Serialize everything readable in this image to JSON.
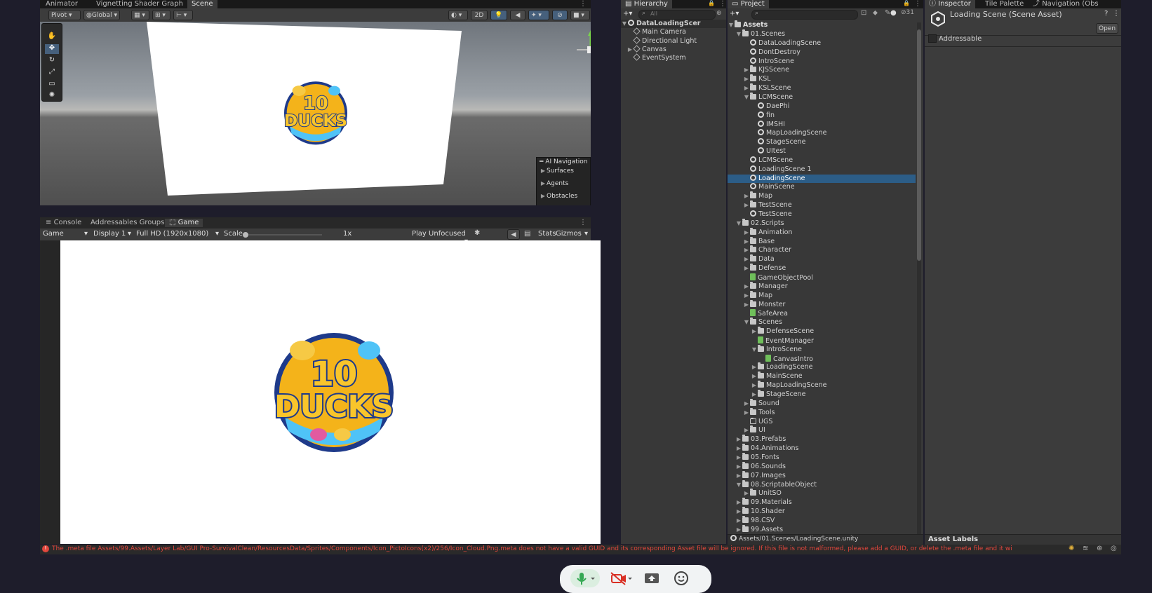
{
  "top_tabs": {
    "animator": "Animator",
    "vignetting": "Vignetting Shader Graph",
    "scene": "Scene",
    "hierarchy": "Hierarchy",
    "project": "Project",
    "inspector": "Inspector",
    "tile_palette": "Tile Palette",
    "navigation": "Navigation (Obs"
  },
  "scene_toolbar": {
    "pivot": "Pivot",
    "global": "Global",
    "mode_2d": "2D"
  },
  "ai_navigation": {
    "title": "AI Navigation",
    "items": [
      "Surfaces",
      "Agents",
      "Obstacles"
    ]
  },
  "bottom_tabs": {
    "console": "Console",
    "addressables": "Addressables Groups",
    "game": "Game"
  },
  "game_toolbar": {
    "view": "Game",
    "display": "Display 1",
    "resolution": "Full HD (1920x1080)",
    "scale_label": "Scale",
    "scale_value": "1x",
    "play_mode": "Play Unfocused",
    "stats": "Stats",
    "gizmos": "Gizmos"
  },
  "logo": {
    "line1": "10",
    "line2": "DUCKS"
  },
  "hierarchy": {
    "search_placeholder": "All",
    "scene": "DataLoadingScer",
    "items": [
      "Main Camera",
      "Directional Light",
      "Canvas",
      "EventSystem"
    ]
  },
  "project": {
    "hidden_count": "31",
    "root": "Assets",
    "path": "Assets/01.Scenes/LoadingScene.unity",
    "tree": [
      {
        "label": "01.Scenes",
        "depth": 1,
        "icon": "folder-open",
        "arrow": "open"
      },
      {
        "label": "DataLoadingScene",
        "depth": 2,
        "icon": "unity"
      },
      {
        "label": "DontDestroy",
        "depth": 2,
        "icon": "unity"
      },
      {
        "label": "IntroScene",
        "depth": 2,
        "icon": "unity"
      },
      {
        "label": "KJSScene",
        "depth": 2,
        "icon": "folder",
        "arrow": "closed"
      },
      {
        "label": "KSL",
        "depth": 2,
        "icon": "folder",
        "arrow": "closed"
      },
      {
        "label": "KSLScene",
        "depth": 2,
        "icon": "folder",
        "arrow": "closed"
      },
      {
        "label": "LCMScene",
        "depth": 2,
        "icon": "folder-open",
        "arrow": "open"
      },
      {
        "label": "DaePhi",
        "depth": 3,
        "icon": "unity"
      },
      {
        "label": "fin",
        "depth": 3,
        "icon": "unity"
      },
      {
        "label": "IMSHI",
        "depth": 3,
        "icon": "unity"
      },
      {
        "label": "MapLoadingScene",
        "depth": 3,
        "icon": "unity"
      },
      {
        "label": "StageScene",
        "depth": 3,
        "icon": "unity"
      },
      {
        "label": "UItest",
        "depth": 3,
        "icon": "unity"
      },
      {
        "label": "LCMScene",
        "depth": 2,
        "icon": "unity"
      },
      {
        "label": "LoadingScene 1",
        "depth": 2,
        "icon": "unity"
      },
      {
        "label": "LoadingScene",
        "depth": 2,
        "icon": "unity",
        "selected": true
      },
      {
        "label": "MainScene",
        "depth": 2,
        "icon": "unity"
      },
      {
        "label": "Map",
        "depth": 2,
        "icon": "folder",
        "arrow": "closed"
      },
      {
        "label": "TestScene",
        "depth": 2,
        "icon": "folder",
        "arrow": "closed"
      },
      {
        "label": "TestScene",
        "depth": 2,
        "icon": "unity"
      },
      {
        "label": "02.Scripts",
        "depth": 1,
        "icon": "folder-open",
        "arrow": "open"
      },
      {
        "label": "Animation",
        "depth": 2,
        "icon": "folder",
        "arrow": "closed"
      },
      {
        "label": "Base",
        "depth": 2,
        "icon": "folder",
        "arrow": "closed"
      },
      {
        "label": "Character",
        "depth": 2,
        "icon": "folder",
        "arrow": "closed"
      },
      {
        "label": "Data",
        "depth": 2,
        "icon": "folder",
        "arrow": "closed"
      },
      {
        "label": "Defense",
        "depth": 2,
        "icon": "folder",
        "arrow": "closed"
      },
      {
        "label": "GameObjectPool",
        "depth": 2,
        "icon": "script"
      },
      {
        "label": "Manager",
        "depth": 2,
        "icon": "folder",
        "arrow": "closed"
      },
      {
        "label": "Map",
        "depth": 2,
        "icon": "folder",
        "arrow": "closed"
      },
      {
        "label": "Monster",
        "depth": 2,
        "icon": "folder",
        "arrow": "closed"
      },
      {
        "label": "SafeArea",
        "depth": 2,
        "icon": "script"
      },
      {
        "label": "Scenes",
        "depth": 2,
        "icon": "folder-open",
        "arrow": "open"
      },
      {
        "label": "DefenseScene",
        "depth": 3,
        "icon": "folder",
        "arrow": "closed"
      },
      {
        "label": "EventManager",
        "depth": 3,
        "icon": "script"
      },
      {
        "label": "IntroScene",
        "depth": 3,
        "icon": "folder-open",
        "arrow": "open"
      },
      {
        "label": "CanvasIntro",
        "depth": 4,
        "icon": "script"
      },
      {
        "label": "LoadingScene",
        "depth": 3,
        "icon": "folder",
        "arrow": "closed"
      },
      {
        "label": "MainScene",
        "depth": 3,
        "icon": "folder",
        "arrow": "closed"
      },
      {
        "label": "MapLoadingScene",
        "depth": 3,
        "icon": "folder",
        "arrow": "closed"
      },
      {
        "label": "StageScene",
        "depth": 3,
        "icon": "folder",
        "arrow": "closed"
      },
      {
        "label": "Sound",
        "depth": 2,
        "icon": "folder",
        "arrow": "closed"
      },
      {
        "label": "Tools",
        "depth": 2,
        "icon": "folder",
        "arrow": "closed"
      },
      {
        "label": "UGS",
        "depth": 2,
        "icon": "folder-empty"
      },
      {
        "label": "UI",
        "depth": 2,
        "icon": "folder",
        "arrow": "closed"
      },
      {
        "label": "03.Prefabs",
        "depth": 1,
        "icon": "folder",
        "arrow": "closed"
      },
      {
        "label": "04.Animations",
        "depth": 1,
        "icon": "folder",
        "arrow": "closed"
      },
      {
        "label": "05.Fonts",
        "depth": 1,
        "icon": "folder",
        "arrow": "closed"
      },
      {
        "label": "06.Sounds",
        "depth": 1,
        "icon": "folder",
        "arrow": "closed"
      },
      {
        "label": "07.Images",
        "depth": 1,
        "icon": "folder",
        "arrow": "closed"
      },
      {
        "label": "08.ScriptableObject",
        "depth": 1,
        "icon": "folder-open",
        "arrow": "open"
      },
      {
        "label": "UnitSO",
        "depth": 2,
        "icon": "folder",
        "arrow": "closed"
      },
      {
        "label": "09.Materials",
        "depth": 1,
        "icon": "folder",
        "arrow": "closed"
      },
      {
        "label": "10.Shader",
        "depth": 1,
        "icon": "folder",
        "arrow": "closed"
      },
      {
        "label": "98.CSV",
        "depth": 1,
        "icon": "folder",
        "arrow": "closed"
      },
      {
        "label": "99.Assets",
        "depth": 1,
        "icon": "folder",
        "arrow": "closed"
      }
    ]
  },
  "inspector": {
    "title": "Loading Scene (Scene Asset)",
    "open_button": "Open",
    "addressable": "Addressable",
    "asset_labels": "Asset Labels"
  },
  "status_bar": {
    "error": "The .meta file Assets/99.Assets/Layer Lab/GUI Pro-SurvivalClean/ResourcesData/Sprites/Components/Icon_PictoIcons(x2)/256/Icon_Cloud.Png.meta does not have a valid GUID and its corresponding Asset file will be ignored. If this file is not malformed, please add a GUID, or delete the .meta file and it wi"
  },
  "colors": {
    "selection": "#2c5d87",
    "error_text": "#e0463c",
    "panel": "#383838",
    "mic_green": "#34a853",
    "camera_red": "#d93025"
  }
}
